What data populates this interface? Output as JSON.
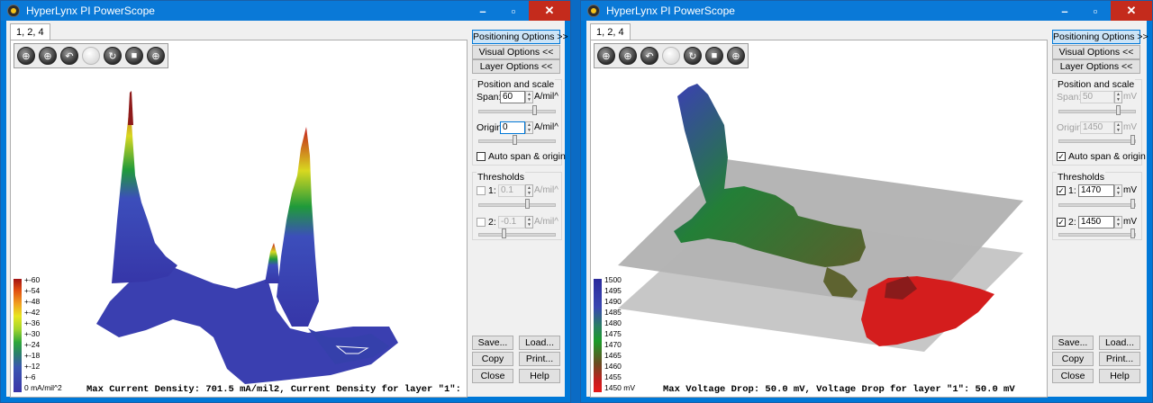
{
  "left": {
    "title": "HyperLynx PI PowerScope",
    "tab": "1, 2, 4",
    "tools": [
      "⊕",
      "⊕",
      "↶",
      "",
      "↻",
      "■",
      "⊕"
    ],
    "legend": {
      "labels": [
        "+-60",
        "+-54",
        "+-48",
        "+-42",
        "+-36",
        "+-30",
        "+-24",
        "+-18",
        "+-12",
        "+-6",
        "0 mA/mil^2"
      ]
    },
    "status": "Max Current Density: 701.5 mA/mil2, Current Density for layer \"1\": 70",
    "buttons": {
      "positioning": "Positioning Options >>",
      "visual": "Visual Options <<",
      "layer": "Layer Options <<",
      "save": "Save...",
      "load": "Load...",
      "copy": "Copy",
      "print": "Print...",
      "close": "Close",
      "help": "Help"
    },
    "position": {
      "title": "Position and scale",
      "span_label": "Span:",
      "span_value": "60",
      "span_unit": "A/mil^",
      "origin_label": "Origin:",
      "origin_value": "0",
      "origin_unit": "A/mil^",
      "auto_label": "Auto span & origin",
      "auto_checked": false
    },
    "thresholds": {
      "title": "Thresholds",
      "t1_label": "1:",
      "t1_value": "0.1",
      "t1_unit": "A/mil^",
      "t2_label": "2:",
      "t2_value": "-0.1",
      "t2_unit": "A/mil^"
    }
  },
  "right": {
    "title": "HyperLynx PI PowerScope",
    "tab": "1, 2, 4",
    "tools": [
      "⊕",
      "⊕",
      "↶",
      "",
      "↻",
      "■",
      "⊕"
    ],
    "legend": {
      "labels": [
        "1500",
        "1495",
        "1490",
        "1485",
        "1480",
        "1475",
        "1470",
        "1465",
        "1460",
        "1455",
        "1450 mV"
      ]
    },
    "status": "Max Voltage Drop: 50.0 mV, Voltage Drop for layer \"1\": 50.0 mV",
    "buttons": {
      "positioning": "Positioning Options >>",
      "visual": "Visual Options <<",
      "layer": "Layer Options <<",
      "save": "Save...",
      "load": "Load...",
      "copy": "Copy",
      "print": "Print...",
      "close": "Close",
      "help": "Help"
    },
    "position": {
      "title": "Position and scale",
      "span_label": "Span:",
      "span_value": "50",
      "span_unit": "mV",
      "origin_label": "Origin:",
      "origin_value": "1450",
      "origin_unit": "mV",
      "auto_label": "Auto span & origin",
      "auto_checked": true
    },
    "thresholds": {
      "title": "Thresholds",
      "t1_label": "1:",
      "t1_value": "1470",
      "t1_unit": "mV",
      "t2_label": "2:",
      "t2_value": "1450",
      "t2_unit": "mV"
    }
  },
  "colors": {
    "titlebar": "#0a79d7",
    "close_btn": "#c42b1c",
    "accent": "#0078d7"
  }
}
